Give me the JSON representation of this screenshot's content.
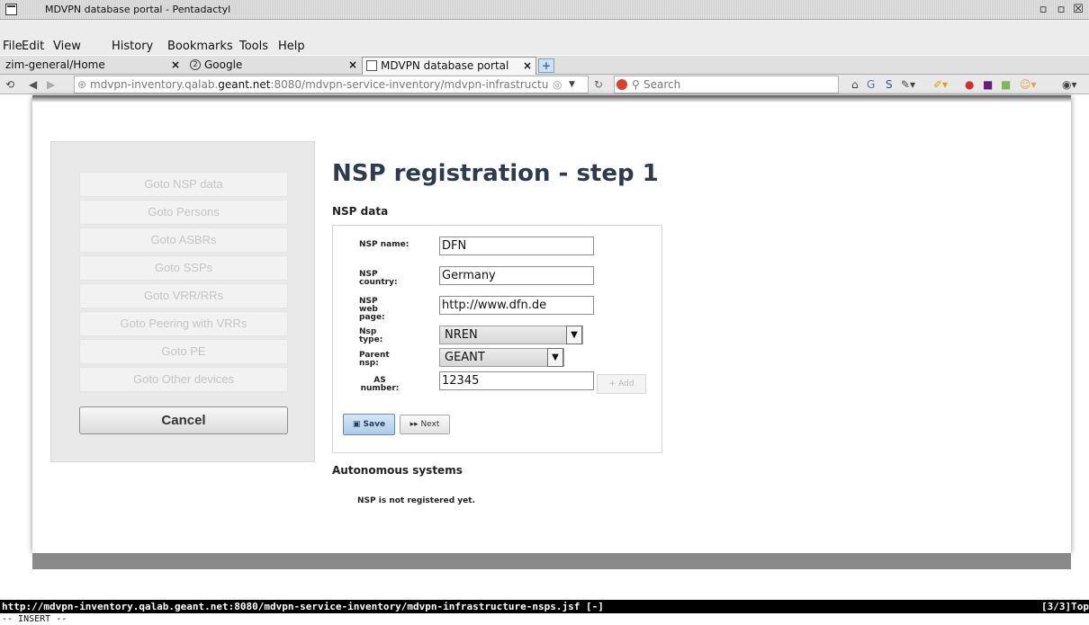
{
  "window": {
    "title": "MDVPN database portal - Pentadactyl",
    "buttons": [
      "▫",
      "▫",
      "☒"
    ]
  },
  "menu": [
    "File",
    "Edit",
    "View",
    "History",
    "Bookmarks",
    "Tools",
    "Help"
  ],
  "tabs": [
    {
      "label": "zim-general/Home",
      "close": "×"
    },
    {
      "label": "Google",
      "close": "×"
    },
    {
      "label": "MDVPN database portal",
      "close": "×"
    }
  ],
  "new_tab_label": "+",
  "nav": {
    "url_plain_prefix": "mdvpn-inventory.qalab.",
    "url_domain": "geant.net",
    "url_rest": ":8080/mdvpn-service-inventory/mdvpn-infrastructu",
    "search_placeholder": "Search"
  },
  "sidebar": {
    "items": [
      "Goto NSP data",
      "Goto Persons",
      "Goto ASBRs",
      "Goto SSPs",
      "Goto VRR/RRs",
      "Goto Peering with VRRs",
      "Goto PE",
      "Goto Other devices"
    ],
    "cancel_label": "Cancel"
  },
  "main": {
    "title": "NSP registration - step 1",
    "section_nsp": "NSP data",
    "section_as": "Autonomous systems",
    "not_registered": "NSP is not registered yet."
  },
  "form": {
    "name_label": "NSP name:",
    "name_value": "DFN",
    "country_label": "NSP country:",
    "country_value": "Germany",
    "web_label": "NSP web page:",
    "web_value": "http://www.dfn.de",
    "type_label": "Nsp type:",
    "type_value": "NREN",
    "parent_label": "Parent nsp:",
    "parent_value": "GEANT",
    "as_label": "AS number:",
    "as_value": "12345",
    "add_label": "Add",
    "save_label": "Save",
    "next_label": "Next"
  },
  "status": {
    "url": "http://mdvpn-inventory.qalab.geant.net:8080/mdvpn-service-inventory/mdvpn-infrastructure-nsps.jsf [-]",
    "position": "[3/3]Top",
    "mode": "-- INSERT --"
  },
  "colors": {
    "title": "#2e3b4e",
    "save_button": "#aecbe6"
  }
}
